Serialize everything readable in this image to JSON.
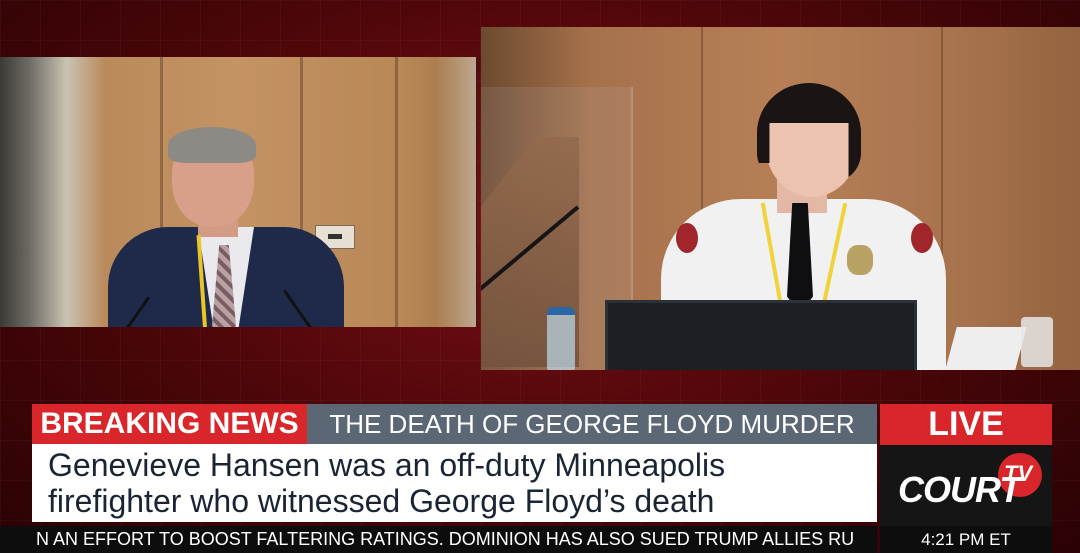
{
  "lower_third": {
    "breaking_label": "BREAKING NEWS",
    "trial_title": "THE DEATH OF GEORGE FLOYD MURDER TRIAL",
    "headline_line1": "Genevieve Hansen was an off-duty Minneapolis",
    "headline_line2": "firefighter who witnessed George Floyd’s death",
    "ticker": "N AN EFFORT TO BOOST FALTERING RATINGS.  DOMINION HAS ALSO SUED TRUMP ALLIES RU"
  },
  "branding": {
    "live_label": "LIVE",
    "logo_text": "COURT",
    "logo_tv": "TV",
    "time": "4:21 PM ET"
  },
  "colors": {
    "red": "#d8262b",
    "slate": "#5c6775",
    "headline_text": "#1a2433",
    "ticker_bg": "#0d0d0d"
  }
}
